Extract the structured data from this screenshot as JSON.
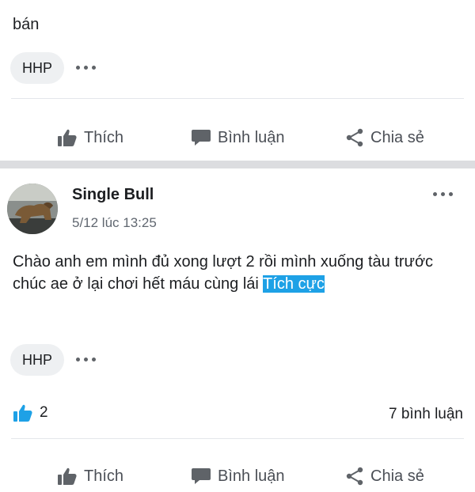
{
  "post1": {
    "body_cut": "bán",
    "tag": "HHP",
    "actions": {
      "like": "Thích",
      "comment": "Bình luận",
      "share": "Chia sẻ"
    }
  },
  "post2": {
    "author": "Single Bull",
    "time": "5/12 lúc 13:25",
    "text": "Chào anh em mình đủ xong lượt 2 rồi mình xuống tàu trước chúc ae ở lại chơi hết máu cùng lái",
    "highlight": "Tích cực",
    "tag": "HHP",
    "likes": "2",
    "comments": "7 bình luận",
    "actions": {
      "like": "Thích",
      "comment": "Bình luận",
      "share": "Chia sẻ"
    }
  },
  "colors": {
    "accent": "#1ea1e6",
    "separator": "#dcdde0",
    "chip": "#eef0f2"
  },
  "icons": [
    "thumbs-up-icon",
    "comment-icon",
    "share-icon",
    "more-dots-icon",
    "like-reaction-icon"
  ]
}
